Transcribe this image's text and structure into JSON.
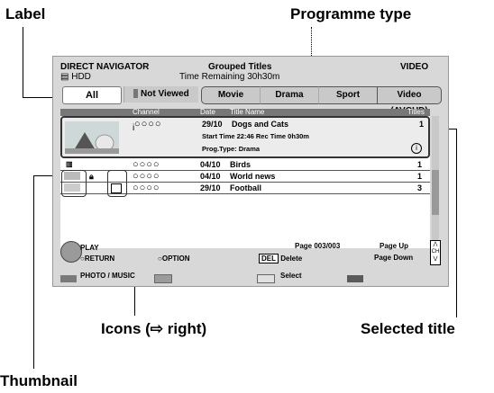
{
  "callouts": {
    "label": "Label",
    "programme_type": "Programme type",
    "icons": "Icons (⇨ right)",
    "selected_title": "Selected title",
    "thumbnail": "Thumbnail"
  },
  "header": {
    "title": "DIRECT NAVIGATOR",
    "drive": "HDD",
    "mode": "Grouped Titles",
    "time_remaining": "Time Remaining   30h30m",
    "category": "VIDEO"
  },
  "tabs": [
    "All",
    "Not Viewed",
    "Movie",
    "Drama",
    "Sport",
    "Video (AVCHD)"
  ],
  "columns": {
    "channel": "Channel",
    "date": "Date",
    "title": "Title Name",
    "titles": "Titles"
  },
  "selected": {
    "channel": "○○○○",
    "date": "29/10",
    "title": "Dogs and Cats",
    "start": "Start Time 22:46   Rec Time 0h30m",
    "prog_type": "Prog.Type: Drama",
    "count": "1"
  },
  "rows": [
    {
      "channel": "○○○○",
      "date": "04/10",
      "title": "Birds",
      "count": "1"
    },
    {
      "channel": "○○○○",
      "date": "04/10",
      "title": "World news",
      "count": "1"
    },
    {
      "channel": "○○○○",
      "date": "29/10",
      "title": "Football",
      "count": "3"
    }
  ],
  "footer": {
    "play": "PLAY",
    "return": "RETURN",
    "option": "OPTION",
    "del_key": "DEL",
    "delete": "Delete",
    "page": "Page 003/003",
    "page_up": "Page Up",
    "page_down": "Page Down",
    "ch": "CH",
    "photo_music": "PHOTO / MUSIC",
    "select": "Select"
  },
  "colors": {
    "red": "#7a7a7a",
    "green": "#9b9b9b",
    "yellow": "#e0e0e0",
    "blue": "#5a5a5a"
  }
}
